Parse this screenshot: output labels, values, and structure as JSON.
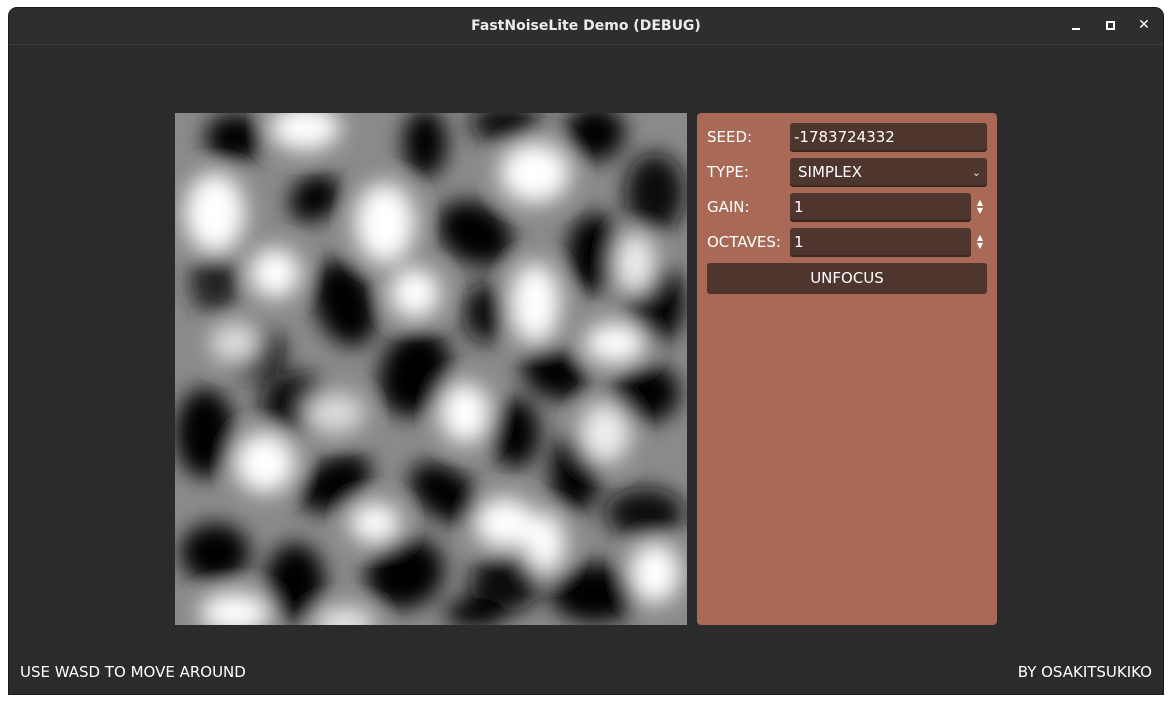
{
  "window": {
    "title": "FastNoiseLite Demo (DEBUG)",
    "controls": [
      "minimize-icon",
      "maximize-icon",
      "close-icon"
    ]
  },
  "panel": {
    "seed_label": "SEED:",
    "seed_value": "-1783724332",
    "type_label": "TYPE:",
    "type_value": "SIMPLEX",
    "gain_label": "GAIN:",
    "gain_value": "1",
    "octaves_label": "OCTAVES:",
    "octaves_value": "1",
    "unfocus_label": "UNFOCUS"
  },
  "footer": {
    "hint": "USE WASD TO MOVE AROUND",
    "credit": "BY OSAKITSUKIKO"
  },
  "colors": {
    "window_bg": "#2b2b2b",
    "panel_bg": "#a86a57",
    "field_bg": "#4e352d",
    "text": "#ffffff"
  }
}
